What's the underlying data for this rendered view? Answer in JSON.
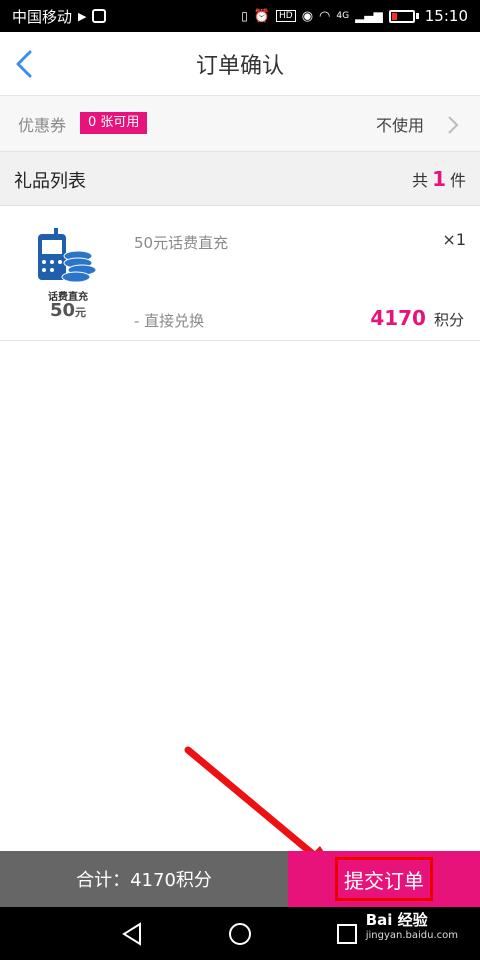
{
  "status_bar": {
    "carrier": "中国移动",
    "network": "4G",
    "time": "15:10"
  },
  "header": {
    "title": "订单确认"
  },
  "coupon": {
    "label": "优惠券",
    "badge": "0 张可用",
    "value": "不使用"
  },
  "gift_list": {
    "title": "礼品列表",
    "count_prefix": "共",
    "count": "1",
    "count_suffix": "件"
  },
  "item": {
    "thumb_caption": "话费直充",
    "thumb_amount": "50",
    "thumb_unit": "元",
    "name": "50元话费直充",
    "quantity": "×1",
    "method": "- 直接兑换",
    "points": "4170",
    "points_unit": "积分"
  },
  "footer": {
    "total": "合计：4170积分",
    "submit": "提交订单"
  },
  "watermark": {
    "brand": "Bai 经验",
    "url": "jingyan.baidu.com"
  },
  "colors": {
    "accent": "#e8137a",
    "back_arrow": "#3a8ee6",
    "total_bg": "#666666"
  }
}
